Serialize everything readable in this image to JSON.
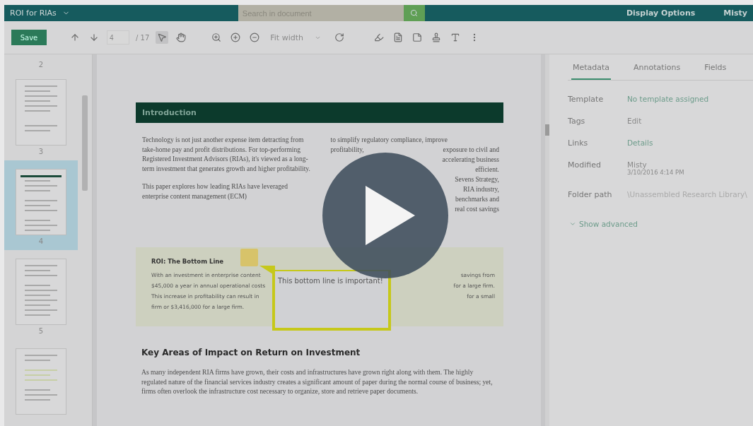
{
  "app_bar": {
    "document_title": "ROI for RIAs",
    "search": {
      "placeholder": "Search in document"
    },
    "display_options": "Display Options",
    "user": "Misty"
  },
  "toolbar": {
    "save": "Save",
    "page": {
      "value": "4",
      "total": "/ 17"
    },
    "tools": [
      {
        "kind": "select",
        "selected": true
      },
      {
        "kind": "pan",
        "selected": false
      }
    ],
    "zoom": "Fit width"
  },
  "thumbnails": {
    "top_label": "2",
    "pages": [
      {
        "label": "3",
        "selected": false,
        "kind": "text"
      },
      {
        "label": "4",
        "selected": true,
        "kind": "intro"
      },
      {
        "label": "5",
        "selected": false,
        "kind": "table"
      },
      {
        "selected": false,
        "kind": "callout"
      }
    ]
  },
  "document": {
    "heading": "Introduction",
    "column_1": [
      "Technology is not just another expense item detracting from take-home pay and profit distributions. For top-performing Registered Investment Advisors (RIAs), it's viewed as a long-term investment that generates growth and higher profitability.",
      "This paper explores how leading RIAs have leveraged enterprise content management (ECM)"
    ],
    "column_2": [
      {
        "left": "to simplify regulatory compliance, improve"
      },
      {
        "left": "profitability,",
        "right": "exposure to civil and"
      },
      {
        "right": "accelerating business"
      },
      {
        "right": "efficient."
      },
      {
        "right": "Sevens Strategy,"
      },
      {
        "right": "RIA industry,"
      },
      {
        "right": "benchmarks and"
      },
      {
        "right": "real cost savings"
      }
    ],
    "callout": {
      "title": "ROI: The Bottom Line",
      "lines": [
        {
          "left": "With an investment in enterprise content",
          "right": "savings from"
        },
        {
          "left": "$45,000 a year in annual operational costs",
          "right": "for a large firm."
        },
        {
          "left": "This increase in profitability can result in",
          "right": "for a small"
        },
        {
          "left": "firm or $3,416,000 for a large firm."
        }
      ]
    },
    "annotation": {
      "text": "This bottom line is important!"
    },
    "section_heading": "Key Areas of Impact on Return on Investment",
    "paragraph": "As many independent RIA firms have grown, their costs and infrastructures have grown right along with them. The highly regulated nature of the financial services industry creates a significant amount of paper during the normal course of business; yet, firms often overlook the infrastructure cost necessary to organize, store and retrieve paper documents."
  },
  "panel": {
    "tabs": [
      {
        "label": "Metadata",
        "selected": true
      },
      {
        "label": "Annotations",
        "selected": false
      },
      {
        "label": "Fields",
        "selected": false
      }
    ],
    "fields": [
      {
        "label": "Template",
        "value": "No template assigned",
        "link": true
      },
      {
        "label": "Tags",
        "value": "Edit",
        "link": false
      },
      {
        "label": "Links",
        "value": "Details",
        "link": true
      },
      {
        "label": "Modified",
        "value": "Misty",
        "detail": "3/10/2016 4:14 PM",
        "link": false
      },
      {
        "label": "Folder path",
        "value": "\\Unassembled Research Library\\",
        "link": false,
        "faint": true
      }
    ],
    "show_advanced": "Show advanced"
  }
}
